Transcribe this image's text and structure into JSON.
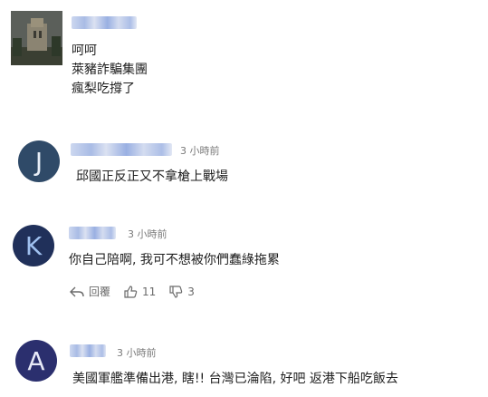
{
  "comments": [
    {
      "time": "",
      "lines": [
        "呵呵",
        "萊豬詐騙集團",
        "瘋梨吃撐了"
      ]
    },
    {
      "avatar_letter": "J",
      "time": "3 小時前",
      "lines": [
        "邱國正反正又不拿槍上戰場"
      ]
    },
    {
      "avatar_letter": "K",
      "time": "3 小時前",
      "lines": [
        "你自己陪啊, 我可不想被你們蠢綠拖累"
      ],
      "actions": {
        "reply_label": "回覆",
        "like_count": "11",
        "dislike_count": "3"
      }
    },
    {
      "avatar_letter": "A",
      "time": "3 小時前",
      "lines": [
        "美國軍艦準備出港, 瞎!! 台灣已淪陷, 好吧 返港下船吃飯去"
      ]
    }
  ],
  "colors": {
    "avatar_j": "#2f4a68",
    "avatar_k": "#20305a",
    "avatar_a": "#2b2f6e"
  }
}
